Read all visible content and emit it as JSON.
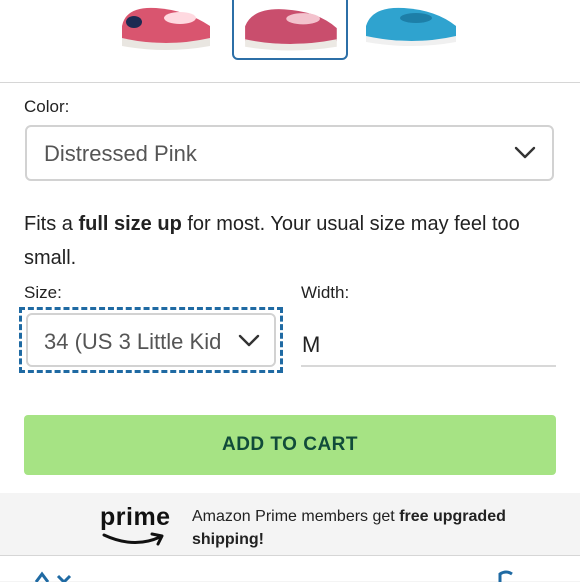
{
  "thumbnails": [
    {
      "name": "thumb-pink-1",
      "color": "#d9556f"
    },
    {
      "name": "thumb-pink-selected",
      "color": "#c94e6d"
    },
    {
      "name": "thumb-blue",
      "color": "#2fa3cf"
    }
  ],
  "color": {
    "label": "Color:",
    "selected_value": "Distressed Pink"
  },
  "fit_note": {
    "prefix": "Fits a ",
    "bold": "full size up",
    "suffix": " for most. Your usual size may feel too small."
  },
  "size": {
    "label": "Size:",
    "selected_value": "34 (US 3 Little Kid"
  },
  "width": {
    "label": "Width:",
    "value": "M"
  },
  "cart": {
    "button_label": "ADD TO CART"
  },
  "prime": {
    "logo_text": "prime",
    "message_prefix": "Amazon Prime members get ",
    "message_bold": "free upgraded shipping!"
  },
  "colors": {
    "accent_blue": "#1f6aa3",
    "cart_green": "#a6e384",
    "cart_text": "#114b3a"
  }
}
